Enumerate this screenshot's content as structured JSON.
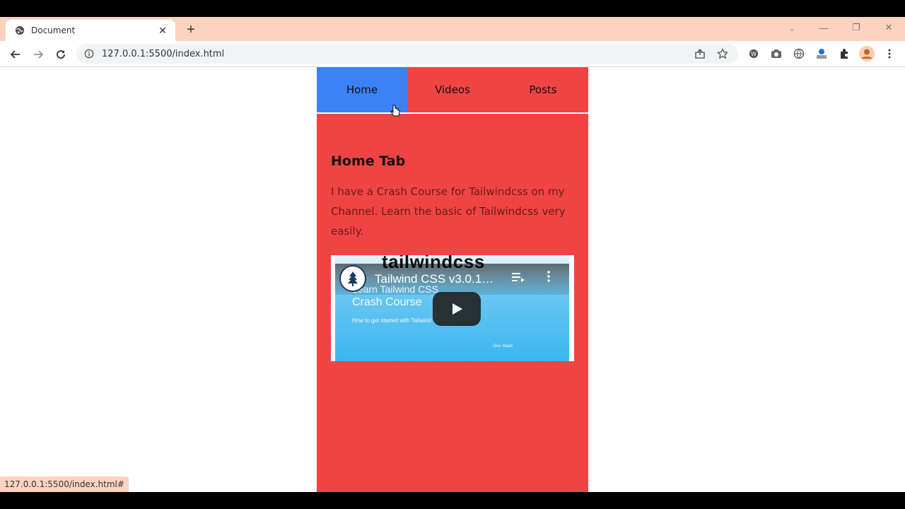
{
  "browser": {
    "tab": {
      "title": "Document",
      "close_label": "✕"
    },
    "newtab_label": "+",
    "window_controls": {
      "search": "⌄",
      "minimize": "—",
      "restore": "❐",
      "close": "✕"
    },
    "url": "127.0.0.1:5500/index.html",
    "status_url": "127.0.0.1:5500/index.html#"
  },
  "app": {
    "tabs": [
      {
        "label": "Home",
        "active": true
      },
      {
        "label": "Videos",
        "active": false
      },
      {
        "label": "Posts",
        "active": false
      }
    ],
    "heading": "Home Tab",
    "paragraph": "I have a Crash Course for Tailwindcss on my Channel. Learn the basic of Tailwindcss very easily."
  },
  "video": {
    "brand": "tailwindcss",
    "title": "Tailwind CSS v3.0.1…",
    "sub1": "Learn Tailwind CSS",
    "sub2": "Crash Course",
    "sub3": "How to get started with Tailwind",
    "sub4": "Dev Stack"
  },
  "colors": {
    "app_bg": "#ef4444",
    "active_tab": "#3b82f6",
    "tabstrip": "#fcd3c1"
  }
}
